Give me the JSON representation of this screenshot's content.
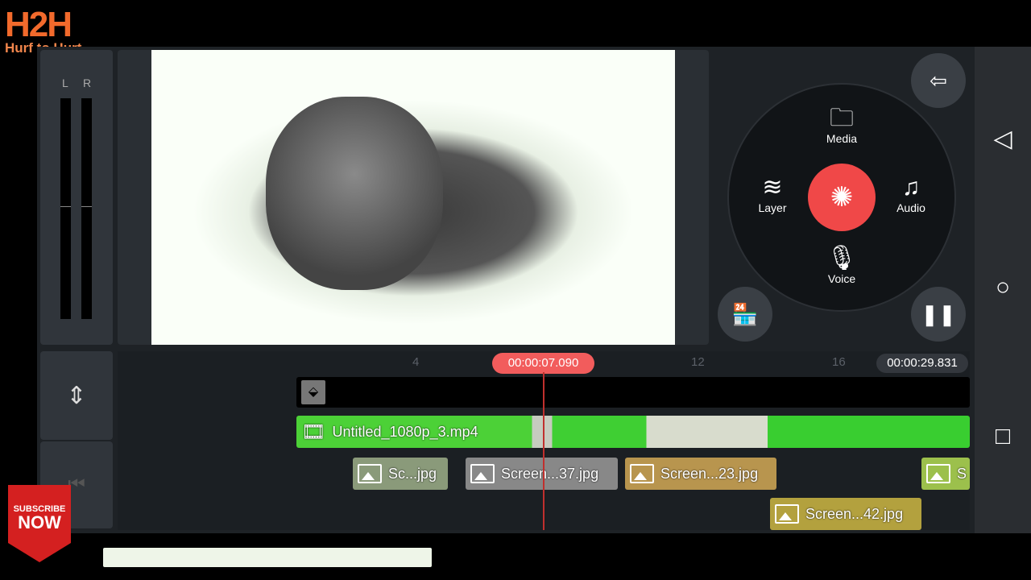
{
  "watermark": {
    "logo": "H2H",
    "tagline": "Hurf to Hurt"
  },
  "meter": {
    "left_label": "L",
    "right_label": "R"
  },
  "wheel": {
    "media": "Media",
    "layer": "Layer",
    "audio": "Audio",
    "voice": "Voice"
  },
  "timeline": {
    "playhead_time": "00:00:07.090",
    "total_duration": "00:00:29.831",
    "ruler_ticks": [
      "4",
      "12",
      "16"
    ],
    "video_clip": "Untitled_1080p_3.mp4",
    "layer_clips": [
      "Sc...jpg",
      "Screen...37.jpg",
      "Screen...23.jpg",
      "S",
      "Screen...42.jpg"
    ]
  },
  "subscribe": {
    "line1": "SUBSCRIBE",
    "line2": "NOW"
  },
  "colors": {
    "accent": "#f25c5c",
    "video_track": "#4cd137"
  }
}
